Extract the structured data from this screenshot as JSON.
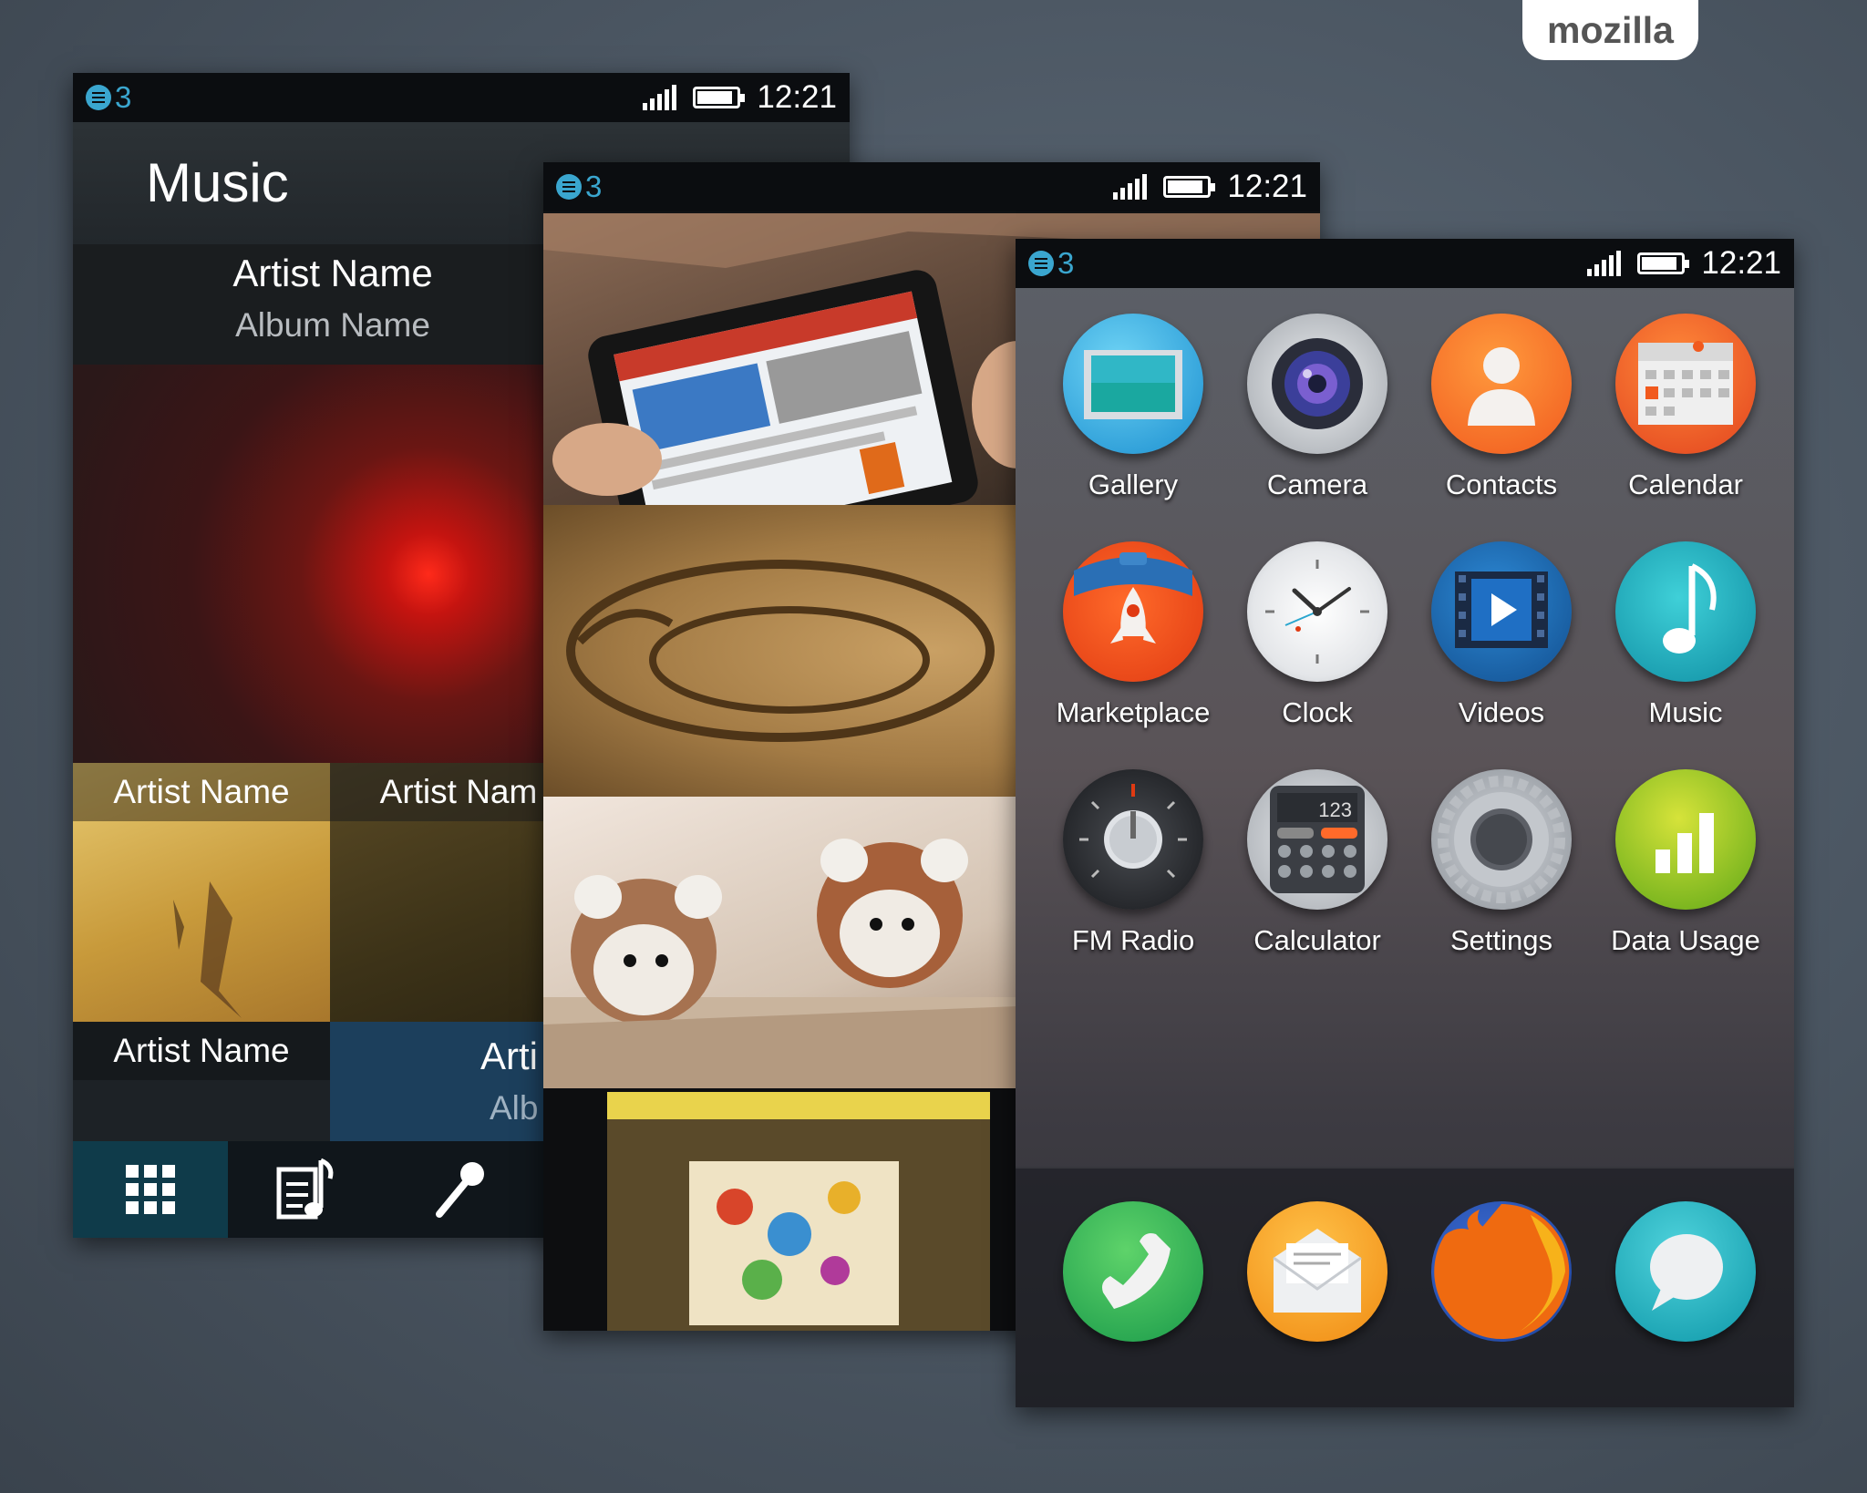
{
  "brand": {
    "label": "mozilla"
  },
  "status": {
    "notification_count": "3",
    "time": "12:21"
  },
  "music": {
    "title": "Music",
    "now_playing": {
      "artist": "Artist Name",
      "album": "Album Name"
    },
    "tiles": [
      {
        "artist": "Artist Name",
        "album": ""
      },
      {
        "artist": "Artist Nam",
        "album": ""
      },
      {
        "artist": "Artist Name",
        "album": ""
      },
      {
        "artist": "Arti",
        "album": "Alb"
      }
    ],
    "tabs": [
      {
        "icon": "grid-icon"
      },
      {
        "icon": "playlist-icon"
      },
      {
        "icon": "microphone-icon"
      }
    ]
  },
  "home": {
    "apps": [
      {
        "label": "Gallery",
        "icon": "gallery-icon",
        "color": "#27a9e1"
      },
      {
        "label": "Camera",
        "icon": "camera-icon",
        "color": "#c9ccd0"
      },
      {
        "label": "Contacts",
        "icon": "contacts-icon",
        "color": "#f2681f"
      },
      {
        "label": "Calendar",
        "icon": "calendar-icon",
        "color": "#f26522"
      },
      {
        "label": "Marketplace",
        "icon": "marketplace-icon",
        "color": "#f4511e"
      },
      {
        "label": "Clock",
        "icon": "clock-icon",
        "color": "#e6e8ea"
      },
      {
        "label": "Videos",
        "icon": "videos-icon",
        "color": "#1b6fb7"
      },
      {
        "label": "Music",
        "icon": "music-icon",
        "color": "#17a7b5"
      },
      {
        "label": "FM Radio",
        "icon": "fm-radio-icon",
        "color": "#2d2f33"
      },
      {
        "label": "Calculator",
        "icon": "calculator-icon",
        "color": "#c7c9cc"
      },
      {
        "label": "Settings",
        "icon": "settings-icon",
        "color": "#9aa0a6"
      },
      {
        "label": "Data Usage",
        "icon": "data-usage-icon",
        "color": "#8dc21f"
      }
    ],
    "dock": [
      {
        "icon": "phone-icon",
        "color": "#23b24b"
      },
      {
        "icon": "email-icon",
        "color": "#f5a623"
      },
      {
        "icon": "browser-icon",
        "color": "#e66000"
      },
      {
        "icon": "messages-icon",
        "color": "#16a9b8"
      }
    ],
    "calculator_display": "123"
  }
}
